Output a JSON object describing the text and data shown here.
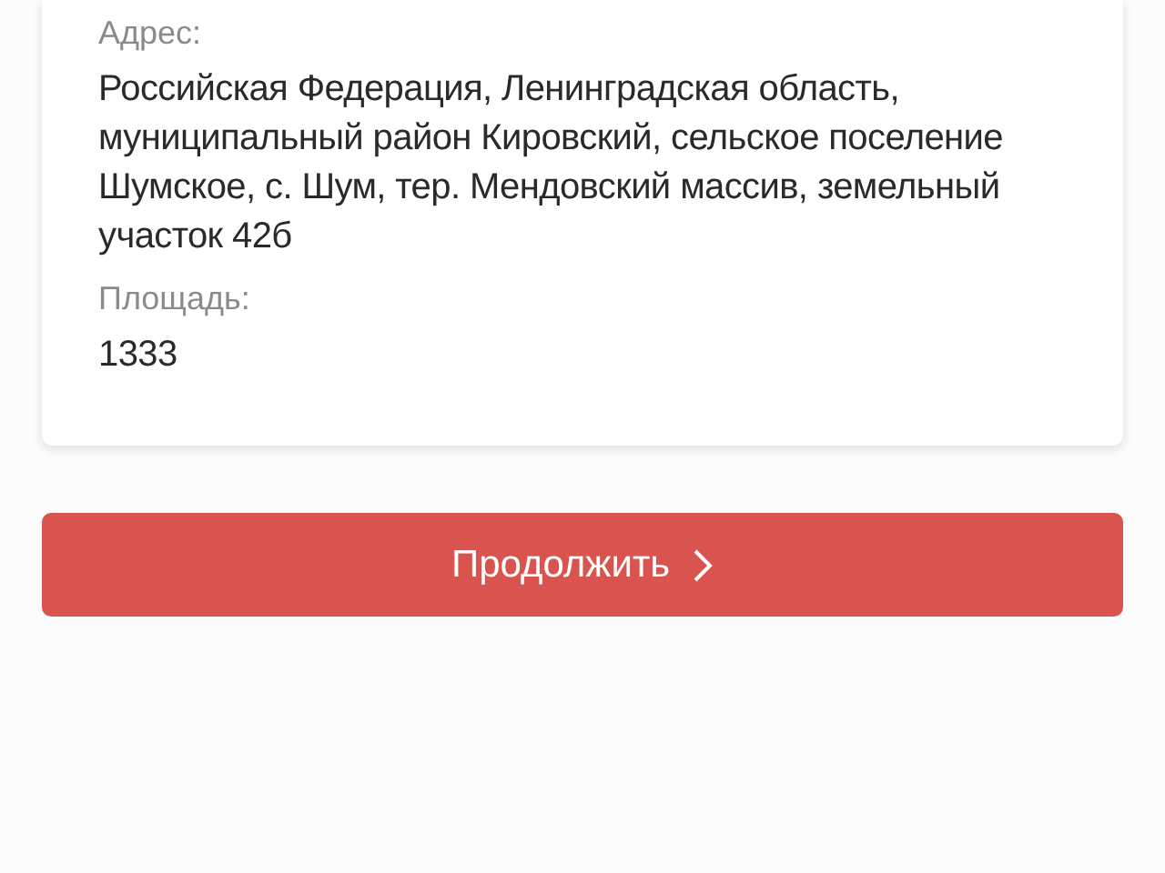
{
  "card": {
    "fields": [
      {
        "label": "Адрес:",
        "value": "Российская Федерация, Ленинградская область, муниципальный район Кировский, сельское поселение Шумское, с. Шум, тер. Мендовский массив, земельный участок 42б"
      },
      {
        "label": "Площадь:",
        "value": "1333"
      }
    ]
  },
  "continue_button": {
    "label": "Продолжить"
  }
}
